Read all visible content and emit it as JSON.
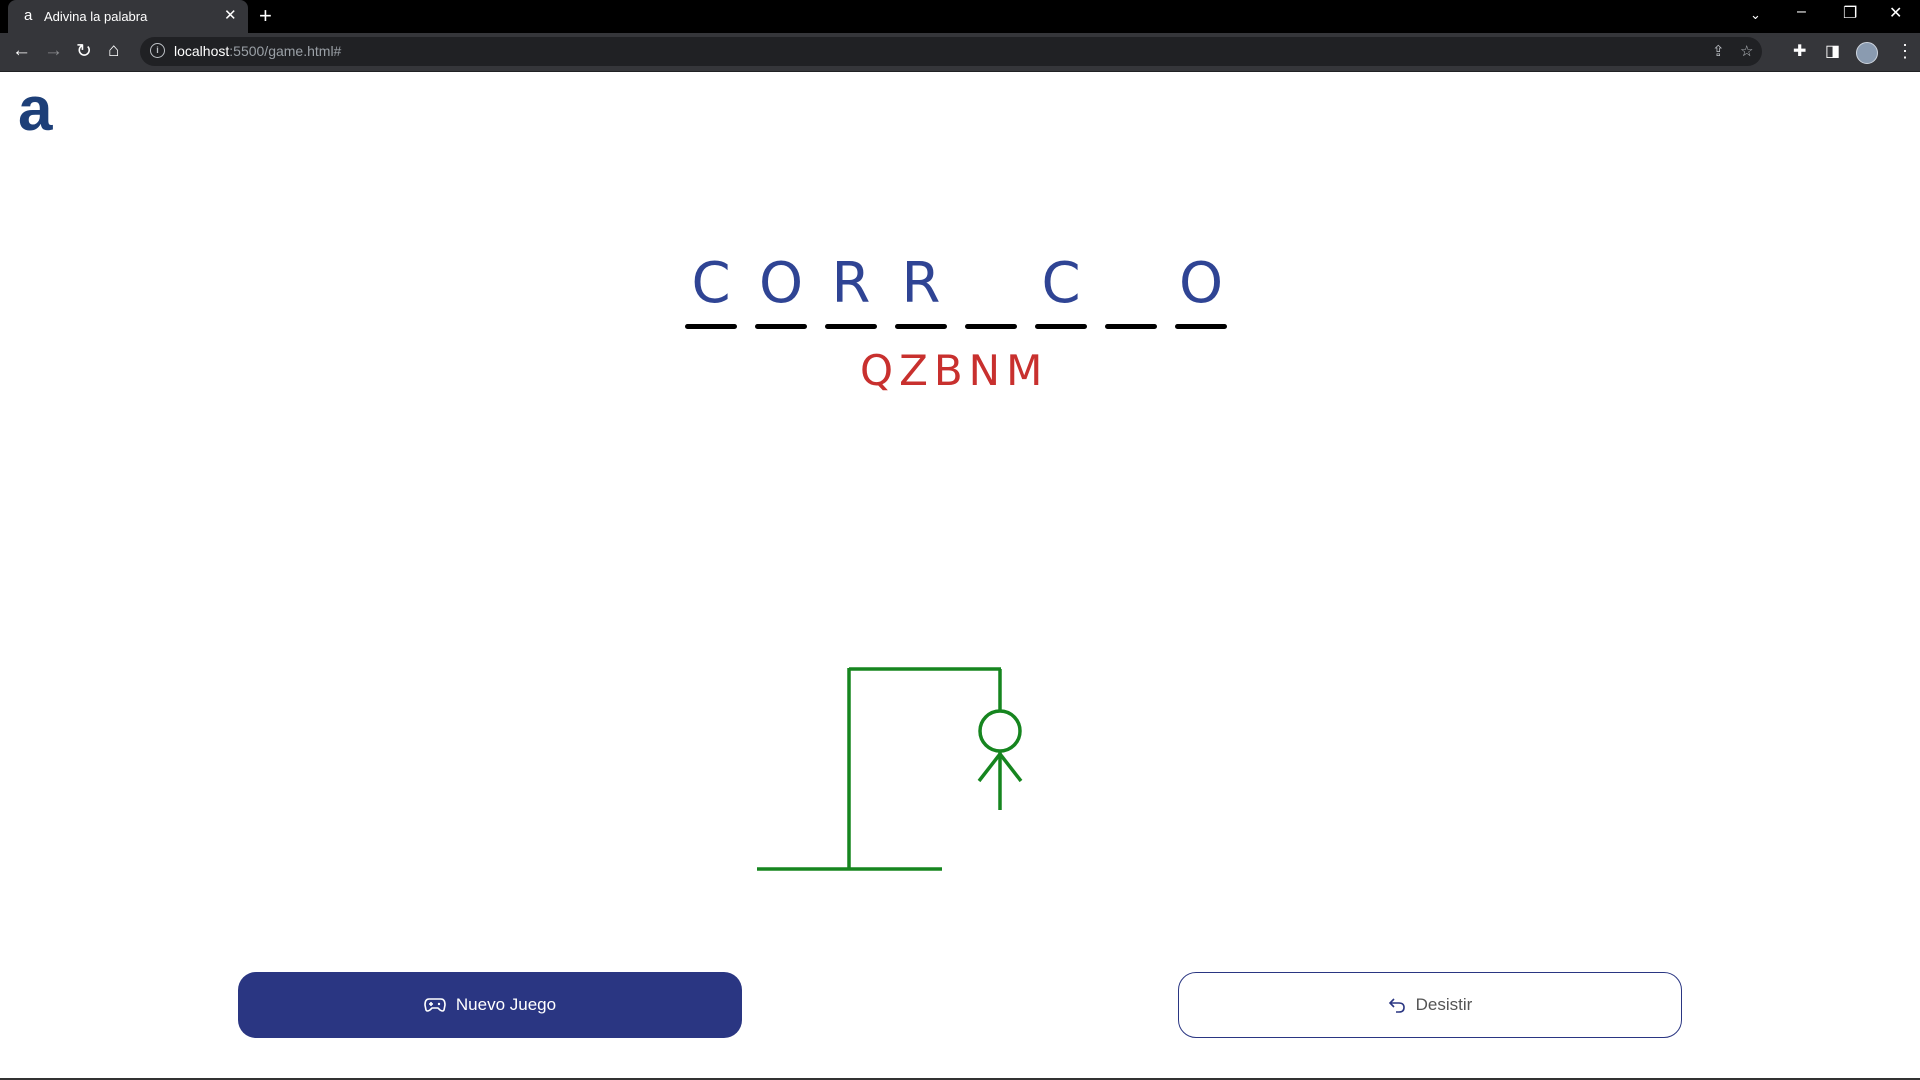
{
  "browser": {
    "tab_title": "Adivina la palabra",
    "tab_favicon": "a",
    "url_host": "localhost",
    "url_rest": ":5500/game.html#"
  },
  "app": {
    "logo_text": "a",
    "logo_color": "#1d3f78"
  },
  "game": {
    "word_slots": [
      "C",
      "O",
      "R",
      "R",
      "",
      "C",
      "",
      "O"
    ],
    "wrong_letters": [
      "Q",
      "Z",
      "B",
      "N",
      "M"
    ],
    "correct_color": "#2f4494",
    "wrong_color": "#c8302e",
    "gallows_color": "#16851f",
    "hangman_parts_shown": [
      "base",
      "post",
      "beam",
      "rope",
      "head",
      "body",
      "left-arm",
      "right-arm"
    ]
  },
  "buttons": {
    "new_game_label": "Nuevo Juego",
    "new_game_icon": "gamepad-icon",
    "give_up_label": "Desistir",
    "give_up_icon": "undo-arrow-icon",
    "primary_color": "#2a3682"
  }
}
